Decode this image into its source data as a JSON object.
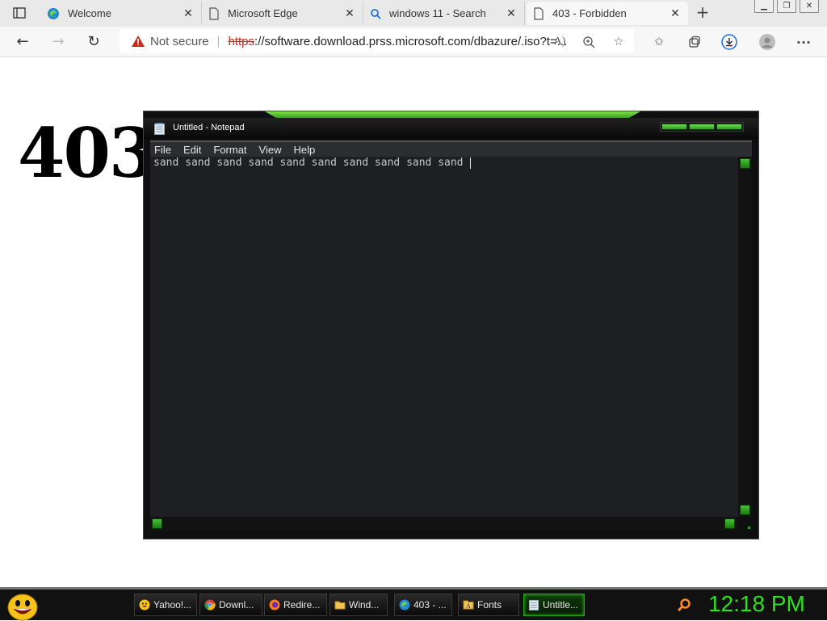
{
  "browser": {
    "tabs": [
      {
        "title": "Welcome",
        "icon": "edge-icon"
      },
      {
        "title": "Microsoft Edge",
        "icon": "page-icon"
      },
      {
        "title": "windows 11 - Search",
        "icon": "search-icon"
      },
      {
        "title": "403 - Forbidden",
        "icon": "page-icon",
        "active": true
      }
    ],
    "address": {
      "security_label": "Not secure",
      "protocol": "https",
      "url_rest": "://software.download.prss.microsoft.com/dbazure/.iso?t=..."
    }
  },
  "page": {
    "heading": "403"
  },
  "notepad": {
    "title": "Untitled - Notepad",
    "menu": [
      "File",
      "Edit",
      "Format",
      "View",
      "Help"
    ],
    "content": "sand sand sand sand sand sand sand sand sand sand "
  },
  "taskbar": {
    "items": [
      {
        "label": "Yahoo!...",
        "icon": "smiley-icon"
      },
      {
        "label": "Downl...",
        "icon": "chrome-icon"
      },
      {
        "label": "Redire...",
        "icon": "firefox-icon"
      },
      {
        "label": "Wind...",
        "icon": "folder-icon"
      },
      {
        "label": "403 - ...",
        "icon": "edge-icon"
      },
      {
        "label": "Fonts",
        "icon": "fonts-icon"
      },
      {
        "label": "Untitle...",
        "icon": "notepad-icon",
        "active": true
      }
    ],
    "clock": "12:18 PM"
  },
  "colors": {
    "accent_green": "#2fe01c",
    "insecure_red": "#c42b1c",
    "editor_bg": "#1d1f22"
  }
}
